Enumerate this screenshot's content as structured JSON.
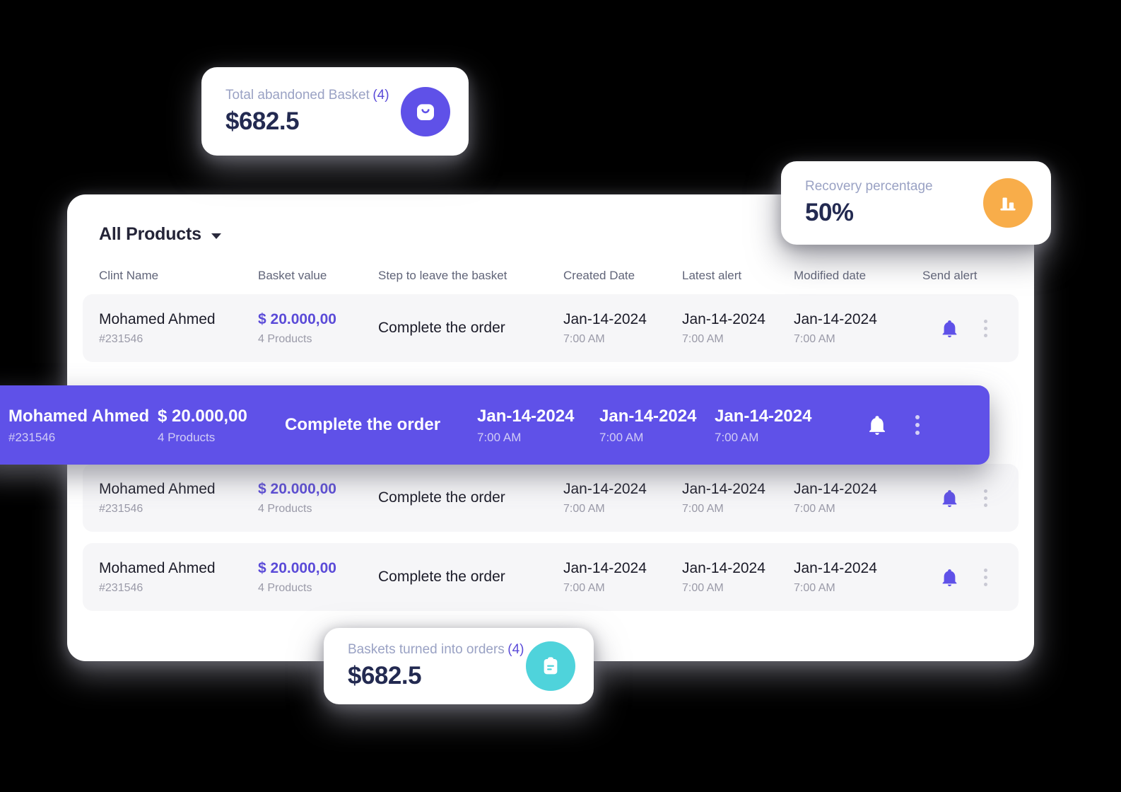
{
  "panel": {
    "title": "All Products",
    "caret_icon": "chevron-down-icon",
    "columns": [
      "Clint Name",
      "Basket value",
      "Step to leave the basket",
      "Created Date",
      "Latest alert",
      "Modified date",
      "Send alert"
    ],
    "rows": [
      {
        "client_name": "Mohamed Ahmed",
        "client_id": "#231546",
        "basket_value": "$ 20.000,00",
        "products": "4 Products",
        "step": "Complete the order",
        "created_date": "Jan-14-2024",
        "created_time": "7:00 AM",
        "latest_alert_date": "Jan-14-2024",
        "latest_alert_time": "7:00 AM",
        "modified_date": "Jan-14-2024",
        "modified_time": "7:00 AM",
        "bell_icon": "bell-icon",
        "menu_icon": "more-vertical-icon"
      },
      {
        "client_name": "Mohamed Ahmed",
        "client_id": "#231546",
        "basket_value": "$ 20.000,00",
        "products": "4 Products",
        "step": "Complete the order",
        "created_date": "Jan-14-2024",
        "created_time": "7:00 AM",
        "latest_alert_date": "Jan-14-2024",
        "latest_alert_time": "7:00 AM",
        "modified_date": "Jan-14-2024",
        "modified_time": "7:00 AM",
        "bell_icon": "bell-icon",
        "menu_icon": "more-vertical-icon"
      },
      {
        "client_name": "Mohamed Ahmed",
        "client_id": "#231546",
        "basket_value": "$ 20.000,00",
        "products": "4 Products",
        "step": "Complete the order",
        "created_date": "Jan-14-2024",
        "created_time": "7:00 AM",
        "latest_alert_date": "Jan-14-2024",
        "latest_alert_time": "7:00 AM",
        "modified_date": "Jan-14-2024",
        "modified_time": "7:00 AM",
        "bell_icon": "bell-icon",
        "menu_icon": "more-vertical-icon"
      }
    ],
    "selected_row": {
      "client_name": "Mohamed Ahmed",
      "client_id": "#231546",
      "basket_value": "$ 20.000,00",
      "products": "4 Products",
      "step": "Complete the order",
      "created_date": "Jan-14-2024",
      "created_time": "7:00 AM",
      "latest_alert_date": "Jan-14-2024",
      "latest_alert_time": "7:00 AM",
      "modified_date": "Jan-14-2024",
      "modified_time": "7:00 AM",
      "bell_icon": "bell-icon",
      "menu_icon": "more-vertical-icon"
    }
  },
  "stats": {
    "abandoned": {
      "label": "Total abandoned Basket",
      "count": "(4)",
      "value": "$682.5",
      "icon": "shopping-bag-icon",
      "icon_color": "#5f51e8"
    },
    "recovery": {
      "label": "Recovery percentage",
      "count": "",
      "value": "50%",
      "icon": "bar-chart-icon",
      "icon_color": "#f8ad4a"
    },
    "orders": {
      "label": "Baskets turned into orders",
      "count": "(4)",
      "value": "$682.5",
      "icon": "clipboard-icon",
      "icon_color": "#4fd3db"
    }
  },
  "colors": {
    "accent_purple": "#5f51e8",
    "value_purple": "#5b4bd8",
    "orange": "#f8ad4a",
    "teal": "#4fd3db",
    "row_bg": "#f6f6f8",
    "dark_navy": "#232a51"
  }
}
